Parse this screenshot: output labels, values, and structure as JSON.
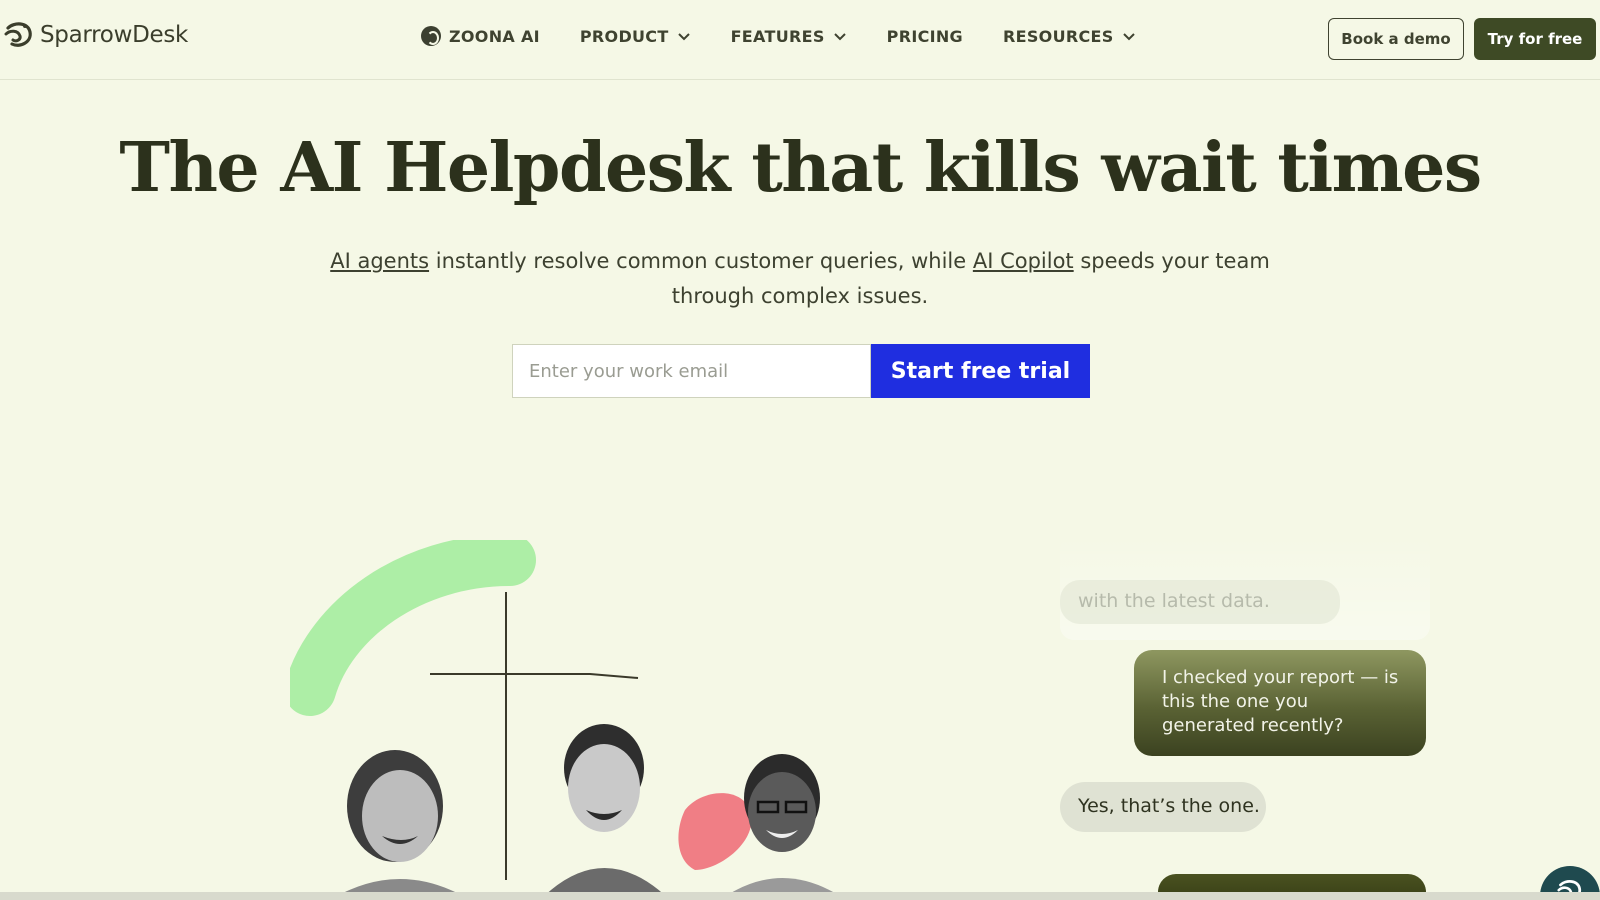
{
  "brand": {
    "name": "SparrowDesk"
  },
  "nav": {
    "items": [
      {
        "label": "ZOONA AI",
        "has_icon": true,
        "has_dropdown": false
      },
      {
        "label": "PRODUCT",
        "has_dropdown": true
      },
      {
        "label": "FEATURES",
        "has_dropdown": true
      },
      {
        "label": "PRICING",
        "has_dropdown": false
      },
      {
        "label": "RESOURCES",
        "has_dropdown": true
      }
    ],
    "book_demo_label": "Book a demo",
    "try_free_label": "Try for free"
  },
  "hero": {
    "title": "The AI Helpdesk that kills wait times",
    "sub_link1": "AI agents",
    "sub_text1": " instantly resolve common customer queries, while ",
    "sub_link2": "AI Copilot",
    "sub_text2": " speeds your team through complex issues.",
    "email_placeholder": "Enter your work email",
    "cta_label": "Start free trial"
  },
  "chat": {
    "faded_message": "with the latest data.",
    "agent_message": "I checked your report — is this the one you generated recently?",
    "user_message": "Yes, that’s the one."
  },
  "colors": {
    "background": "#f5f8e6",
    "cta_blue": "#1f2ee0",
    "brand_dark_green": "#3e4a25",
    "heading": "#2c311c"
  }
}
